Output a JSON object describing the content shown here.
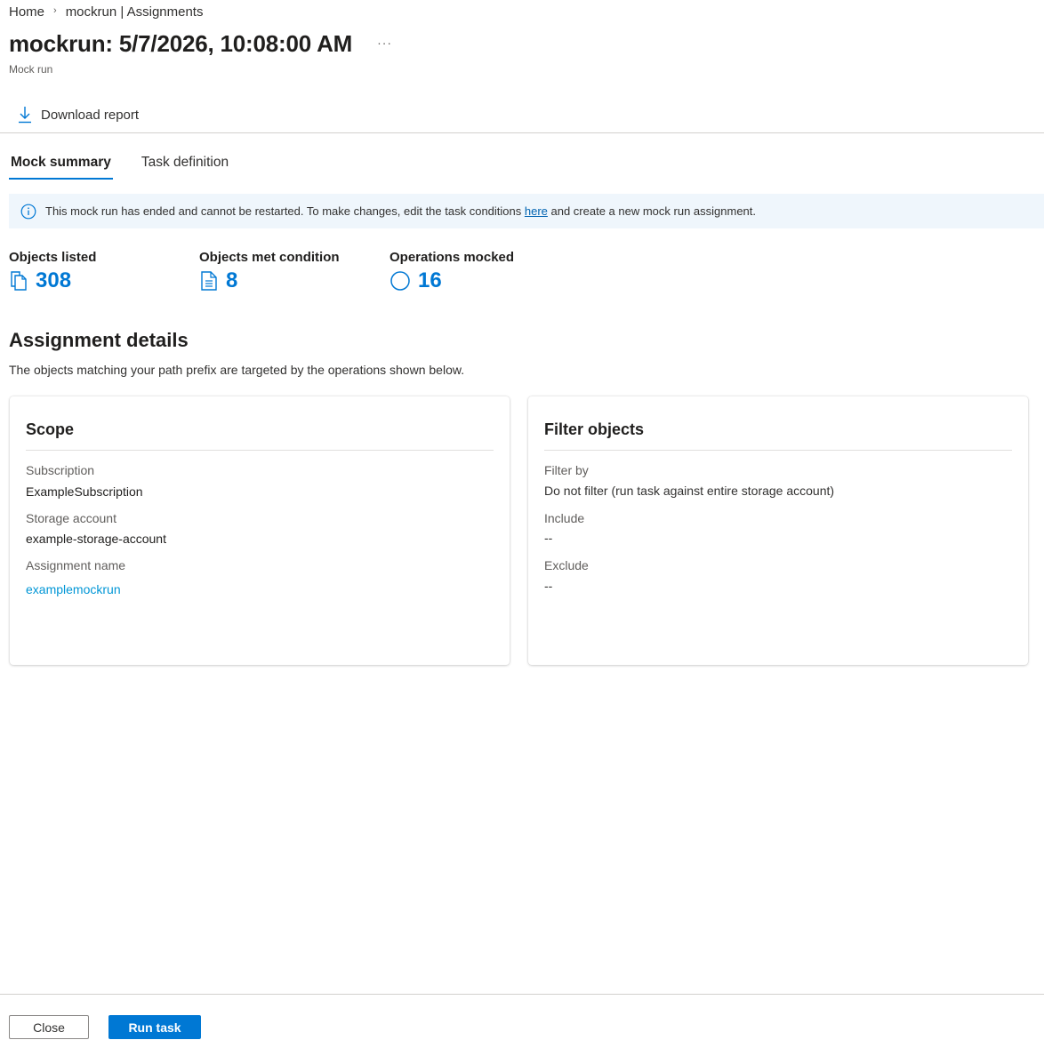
{
  "breadcrumb": {
    "home": "Home",
    "separator": "›",
    "current": "mockrun | Assignments"
  },
  "header": {
    "title": "mockrun: 5/7/2026, 10:08:00 AM",
    "more": "···",
    "subtitle": "Mock run"
  },
  "toolbar": {
    "download_label": "Download report",
    "download_icon": "download-icon"
  },
  "tabs": [
    {
      "label": "Mock summary",
      "active": true
    },
    {
      "label": "Task definition",
      "active": false
    }
  ],
  "info": {
    "icon": "info-icon",
    "text_before": "This mock run has ended and cannot be restarted. To make changes, edit the task conditions ",
    "link": "here",
    "text_after": " and create a new mock run assignment."
  },
  "metrics": [
    {
      "label": "Objects listed",
      "value": "308",
      "icon": "copy-documents-icon"
    },
    {
      "label": "Objects met condition",
      "value": "8",
      "icon": "document-icon"
    },
    {
      "label": "Operations mocked",
      "value": "16",
      "icon": "circle-icon"
    }
  ],
  "assignment": {
    "title": "Assignment details",
    "description": "The objects matching your path prefix are targeted by the operations shown below."
  },
  "scope": {
    "title": "Scope",
    "subscription_label": "Subscription",
    "subscription_value": "ExampleSubscription",
    "storage_label": "Storage account",
    "storage_value": "example-storage-account",
    "assignment_label": "Assignment name",
    "assignment_value": "examplemockrun"
  },
  "filter": {
    "title": "Filter objects",
    "filter_by_label": "Filter by",
    "filter_by_value": "Do not filter (run task against entire storage account)",
    "include_label": "Include",
    "include_value": "--",
    "exclude_label": "Exclude",
    "exclude_value": "--"
  },
  "footer": {
    "close_label": "Close",
    "run_label": "Run task"
  },
  "colors": {
    "accent": "#0078d4",
    "info_bg": "#eff6fc",
    "link": "#0096d6"
  }
}
